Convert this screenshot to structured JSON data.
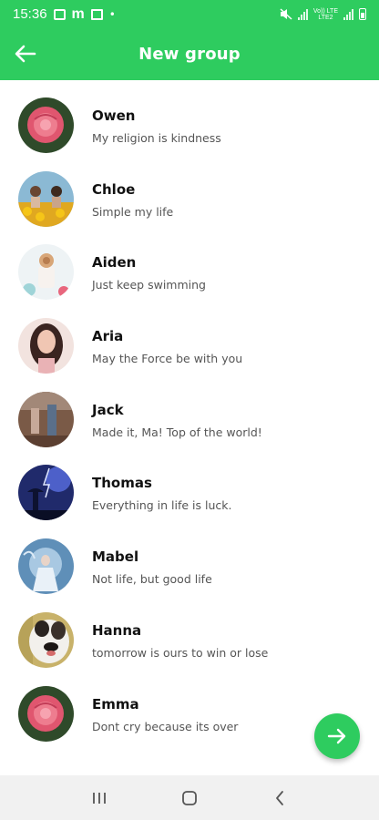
{
  "status_bar": {
    "time": "15:36",
    "volte_label": "Vo)) LTE",
    "lte_label": "LTE2"
  },
  "app_bar": {
    "title": "New group",
    "back_icon": "arrow-left-icon"
  },
  "contacts": [
    {
      "name": "Owen",
      "status": "My religion is kindness",
      "avatar": "rose"
    },
    {
      "name": "Chloe",
      "status": "Simple my life",
      "avatar": "sunflower-girls"
    },
    {
      "name": "Aiden",
      "status": "Just keep swimming",
      "avatar": "dessert"
    },
    {
      "name": "Aria",
      "status": "May the Force be with you",
      "avatar": "portrait"
    },
    {
      "name": "Jack",
      "status": "Made it, Ma! Top of the world!",
      "avatar": "couple"
    },
    {
      "name": "Thomas",
      "status": "Everything in life is luck.",
      "avatar": "storm"
    },
    {
      "name": "Mabel",
      "status": "Not life, but good life",
      "avatar": "ice-angel"
    },
    {
      "name": "Hanna",
      "status": "tomorrow is ours to win or lose",
      "avatar": "dog"
    },
    {
      "name": "Emma",
      "status": "Dont cry because its over",
      "avatar": "rose"
    }
  ],
  "fab": {
    "icon": "arrow-right-icon"
  },
  "nav_bar": {
    "recents_icon": "recents-icon",
    "home_icon": "home-icon",
    "back_icon": "back-chevron-icon"
  },
  "colors": {
    "primary": "#2ecc5f",
    "nav_bg": "#f1f1f1"
  }
}
